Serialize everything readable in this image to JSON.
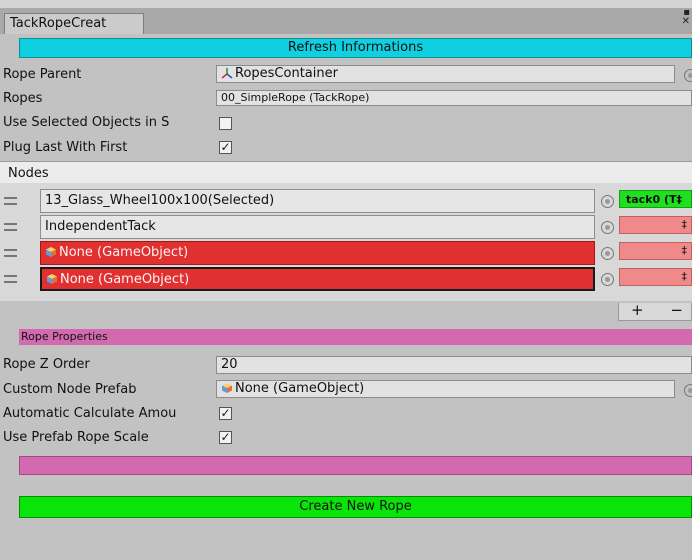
{
  "window": {
    "tab_title": "TackRopeCreat",
    "menu_glyph": "▪",
    "close_glyph": "✕"
  },
  "refresh_button": "Refresh Informations",
  "rope_parent": {
    "label": "Rope Parent",
    "value": "RopesContainer"
  },
  "ropes": {
    "label": "Ropes",
    "value": "00_SimpleRope (TackRope)"
  },
  "use_selected": {
    "label": "Use Selected Objects in S",
    "checked": false
  },
  "plug_last": {
    "label": "Plug Last With First",
    "checked": true
  },
  "nodes": {
    "header": "Nodes",
    "items": [
      {
        "value": "13_Glass_Wheel100x100(Selected)",
        "style": "grey",
        "tack": "tack0 (T‡",
        "tack_style": "green"
      },
      {
        "value": "IndependentTack",
        "style": "grey",
        "tack": "‡",
        "tack_style": "pink"
      },
      {
        "value": "None (GameObject)",
        "style": "red",
        "tack": "‡",
        "tack_style": "pink"
      },
      {
        "value": "None (GameObject)",
        "style": "red-selected",
        "tack": "‡",
        "tack_style": "pink"
      }
    ],
    "add_glyph": "+",
    "remove_glyph": "−"
  },
  "rope_properties": {
    "header": "Rope Properties",
    "z_order": {
      "label": "Rope Z Order",
      "value": "20"
    },
    "custom_prefab": {
      "label": "Custom Node Prefab",
      "value": "None (GameObject)"
    },
    "auto_calc": {
      "label": "Automatic Calculate Amou",
      "checked": true
    },
    "use_prefab_scale": {
      "label": "Use Prefab Rope Scale",
      "checked": true
    }
  },
  "create_button": "Create New Rope",
  "colors": {
    "cyan": "#10d0e0",
    "green": "#09e409",
    "pink": "#d36ab0",
    "red": "#e03030"
  }
}
